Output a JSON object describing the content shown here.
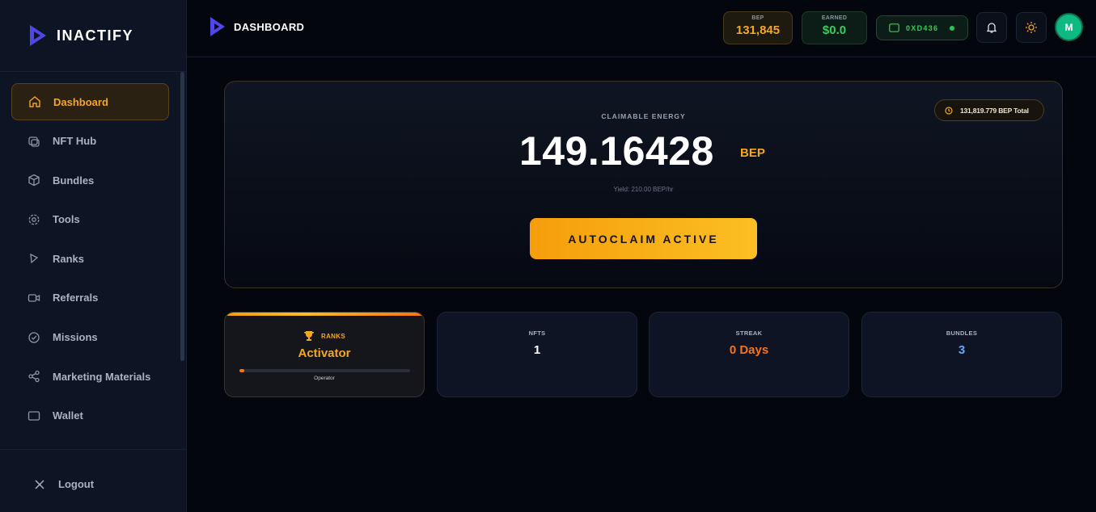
{
  "app": {
    "name": "INACTIFY"
  },
  "sidebar": {
    "items": [
      {
        "label": "Dashboard",
        "icon": "home-icon",
        "active": true
      },
      {
        "label": "NFT Hub",
        "icon": "nft-icon"
      },
      {
        "label": "Bundles",
        "icon": "box-icon"
      },
      {
        "label": "Tools",
        "icon": "gear-icon"
      },
      {
        "label": "Ranks",
        "icon": "rank-icon"
      },
      {
        "label": "Referrals",
        "icon": "video-icon"
      },
      {
        "label": "Missions",
        "icon": "check-circle-icon"
      },
      {
        "label": "Marketing Materials",
        "icon": "share-icon"
      },
      {
        "label": "Wallet",
        "icon": "wallet-icon"
      }
    ],
    "logout_label": "Logout"
  },
  "header": {
    "title": "DASHBOARD",
    "bep": {
      "label": "BEP",
      "value": "131,845"
    },
    "earned": {
      "label": "EARNED",
      "value": "$0.0"
    },
    "wallet": {
      "address": "0XD436"
    },
    "avatar_initial": "M"
  },
  "claim": {
    "total_badge": "131,819.779 BEP Total",
    "label": "CLAIMABLE ENERGY",
    "value": "149.16428",
    "unit": "BEP",
    "yield": "Yield: 210.00 BEP/hr",
    "button_label": "AUTOCLAIM ACTIVE"
  },
  "stats": {
    "ranks": {
      "label": "RANKS",
      "rank": "Activator",
      "next": "Operator",
      "progress": 0.03
    },
    "nfts": {
      "label": "NFTS",
      "value": "1"
    },
    "streak": {
      "label": "STREAK",
      "value": "0 Days"
    },
    "bundles": {
      "label": "BUNDLES",
      "value": "3"
    }
  },
  "colors": {
    "accent": "#f5a623",
    "success": "#34d058",
    "info": "#60a5fa",
    "streak": "#f97316"
  }
}
